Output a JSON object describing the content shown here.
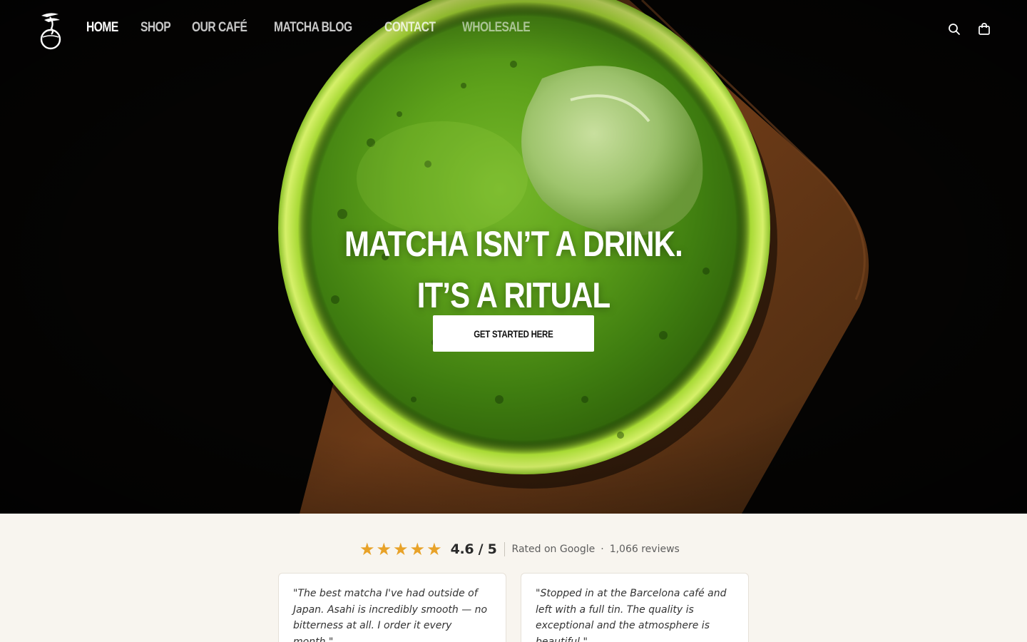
{
  "nav": {
    "links": [
      {
        "label": "HOME",
        "active": true
      },
      {
        "label": "SHOP",
        "active": false
      },
      {
        "label": "OUR CAFÉ",
        "active": false
      },
      {
        "label": "MATCHA BLOG",
        "active": false
      },
      {
        "label": "CONTACT",
        "active": false
      },
      {
        "label": "WHOLESALE",
        "active": false
      }
    ],
    "icons": [
      "search-icon",
      "cart-icon"
    ]
  },
  "hero": {
    "headline_1": "MATCHA ISN’T A DRINK.",
    "headline_2": "IT’S A RITUAL",
    "cta_label": "GET STARTED HERE"
  },
  "rating": {
    "stars": 5,
    "score": "4.6 / 5",
    "source": "Rated on Google",
    "separator": "·",
    "count": "1,066 reviews"
  },
  "reviews": [
    {
      "quote": "\"The best matcha I've had outside of Japan. Asahi is incredibly smooth — no bitterness at all. I order it every month.\""
    },
    {
      "quote": "\"Stopped in at the Barcelona café and left with a full tin. The quality is exceptional and the atmosphere is beautiful.\""
    }
  ],
  "colors": {
    "star": "#e8a228",
    "matcha_green": "#5fae1e",
    "page_bg": "#f8f5ef"
  }
}
